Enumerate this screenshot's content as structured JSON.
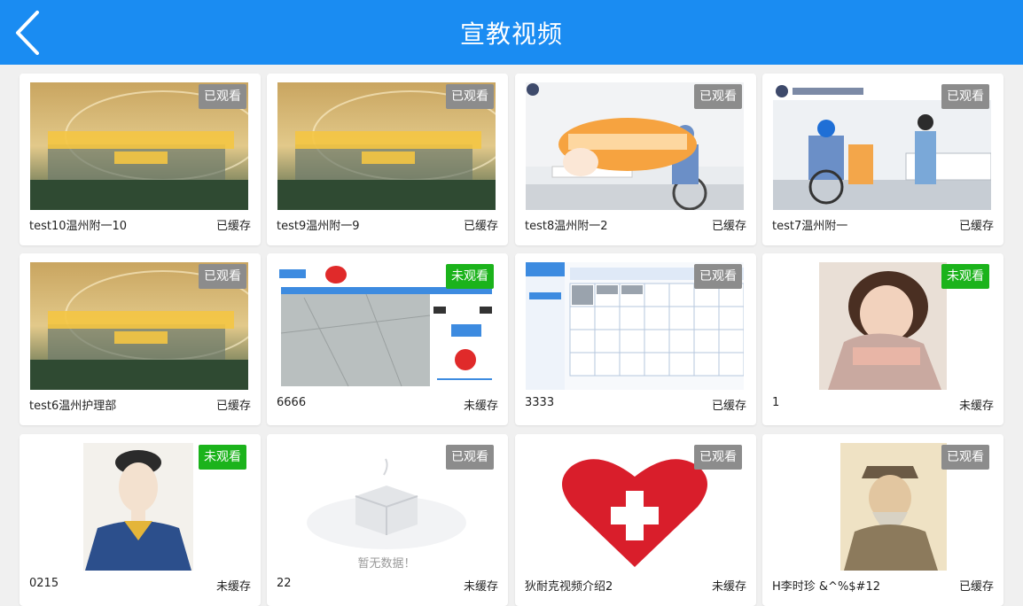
{
  "header": {
    "title": "宣教视频"
  },
  "colors": {
    "header_bg": "#1a8cf2",
    "seen_badge": "#8c8c8c",
    "unseen_badge": "#1bb31b"
  },
  "videos": [
    {
      "name": "test10温州附一10",
      "status": "已观看",
      "cache": "已缓存",
      "watched": true,
      "thumb": "campus-photo"
    },
    {
      "name": "test9温州附一9",
      "status": "已观看",
      "cache": "已缓存",
      "watched": true,
      "thumb": "campus-photo"
    },
    {
      "name": "test8温州附一2",
      "status": "已观看",
      "cache": "已缓存",
      "watched": true,
      "thumb": "wheelchair-transfer-photo"
    },
    {
      "name": "test7温州附一",
      "status": "已观看",
      "cache": "已缓存",
      "watched": true,
      "thumb": "hospital-ward-photo"
    },
    {
      "name": "test6温州护理部",
      "status": "已观看",
      "cache": "已缓存",
      "watched": true,
      "thumb": "campus-photo"
    },
    {
      "name": "6666",
      "status": "未观看",
      "cache": "未缓存",
      "watched": false,
      "thumb": "app-screenshot"
    },
    {
      "name": "3333",
      "status": "已观看",
      "cache": "已缓存",
      "watched": true,
      "thumb": "calendar-screenshot"
    },
    {
      "name": "1",
      "status": "未观看",
      "cache": "未缓存",
      "watched": false,
      "thumb": "portrait-photo"
    },
    {
      "name": "0215",
      "status": "未观看",
      "cache": "未缓存",
      "watched": false,
      "thumb": "costume-illustration"
    },
    {
      "name": "22",
      "status": "已观看",
      "cache": "未缓存",
      "watched": true,
      "thumb": "empty-box",
      "thumb_caption": "暂无数据！"
    },
    {
      "name": "狄耐克视频介绍2",
      "status": "已观看",
      "cache": "未缓存",
      "watched": true,
      "thumb": "heart-cross"
    },
    {
      "name": "H李时珍 &^%$#12",
      "status": "已观看",
      "cache": "已缓存",
      "watched": true,
      "thumb": "scholar-portrait"
    }
  ]
}
